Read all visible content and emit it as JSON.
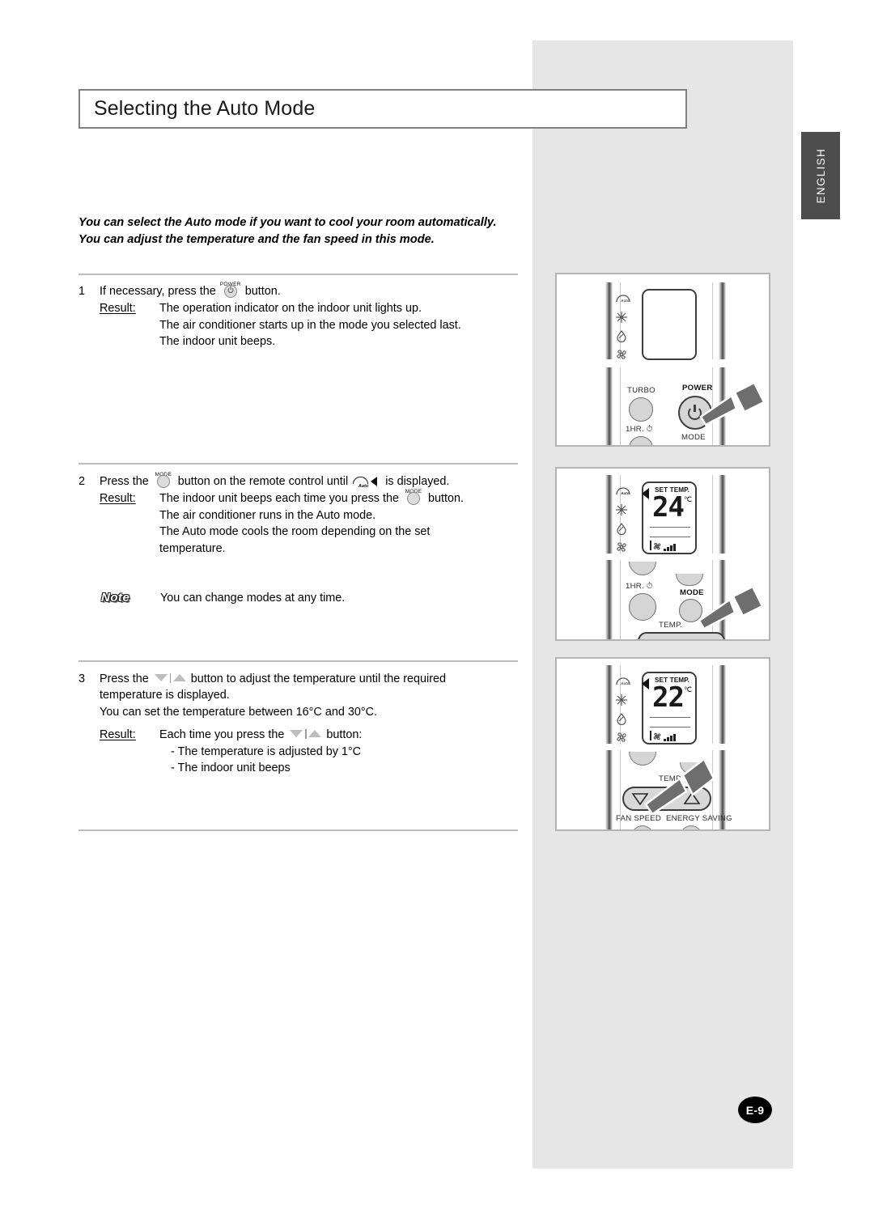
{
  "page": {
    "title": "Selecting the Auto Mode",
    "language_tab": "ENGLISH",
    "page_number": "E-9",
    "intro": "You can select the Auto mode if you want to cool your room automatically. You can adjust the temperature and the fan speed in this mode."
  },
  "steps": [
    {
      "number": "1",
      "text_before": "If necessary, press the",
      "inline_icon": "power-button-icon",
      "inline_icon_label": "POWER",
      "text_after": "button.",
      "result_label": "Result:",
      "result_lines": [
        "The operation indicator on the indoor unit lights up.",
        "The air conditioner starts up in the mode you selected last.",
        "The indoor unit beeps."
      ]
    },
    {
      "number": "2",
      "text_before": "Press the",
      "inline_icon": "mode-button-icon",
      "inline_icon_label": "MODE",
      "text_mid": "button on the remote control until",
      "inline_icon_2": "auto-mode-icon",
      "text_after": "is displayed.",
      "result_label": "Result:",
      "result_line_1_before": "The indoor unit beeps each time you press the",
      "result_line_1_after": "button.",
      "result_lines": [
        "The air conditioner runs in the Auto mode.",
        "The Auto mode cools the room depending on the set",
        "temperature."
      ]
    },
    {
      "number": "3",
      "text_before": "Press the",
      "inline_icon": "temp-down-up-icon",
      "text_after": "button to adjust the temperature until the required",
      "line_2": "temperature is displayed.",
      "line_3": "You can set the temperature between 16°C and 30°C.",
      "result_label": "Result:",
      "result_line_1_before": "Each time you press the",
      "result_line_1_after": "button:",
      "result_lines": [
        "- The temperature is adjusted by 1°C",
        "- The indoor unit beeps"
      ]
    }
  ],
  "note": {
    "word": "Note",
    "text": "You can change modes at any time."
  },
  "remotes": [
    {
      "name": "remote-power-step",
      "mode_icons": [
        "auto-mode-icon",
        "snowflake-icon",
        "dehumidify-droplet-icon",
        "fan-icon"
      ],
      "lcd": {
        "visible": false,
        "set_temp_label": "",
        "temperature": "",
        "unit": ""
      },
      "labels": {
        "turbo": "TURBO",
        "hour": "1HR.",
        "power": "POWER",
        "mode": "MODE"
      },
      "highlight": "power-button"
    },
    {
      "name": "remote-mode-step",
      "mode_icons": [
        "auto-mode-icon",
        "snowflake-icon",
        "dehumidify-droplet-icon",
        "fan-icon"
      ],
      "lcd": {
        "visible": true,
        "set_temp_label": "SET TEMP.",
        "temperature": "24",
        "unit": "℃"
      },
      "labels": {
        "hour": "1HR.",
        "mode": "MODE",
        "temp": "TEMP."
      },
      "highlight": "mode-button"
    },
    {
      "name": "remote-temp-step",
      "mode_icons": [
        "auto-mode-icon",
        "snowflake-icon",
        "dehumidify-droplet-icon",
        "fan-icon"
      ],
      "lcd": {
        "visible": true,
        "set_temp_label": "SET TEMP.",
        "temperature": "22",
        "unit": "℃"
      },
      "labels": {
        "temp": "TEMP.",
        "fan_speed": "FAN SPEED",
        "energy_saving": "ENERGY SAVING"
      },
      "highlight": "temp-rocker"
    }
  ],
  "colors": {
    "panel_gray": "#e6e6e6",
    "tab_gray": "#4d4d4d",
    "rule_gray": "#bdbdbd",
    "border_gray": "#808080",
    "text": "#000000"
  }
}
